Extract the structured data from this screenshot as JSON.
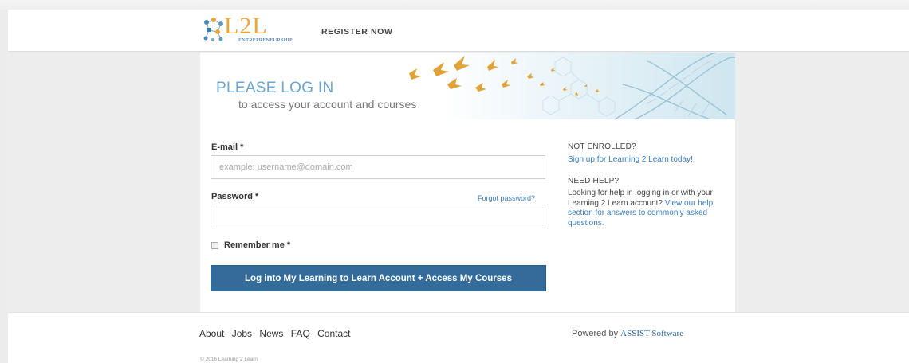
{
  "header": {
    "logo": {
      "main_text": "L2L",
      "sub_text": "ENTREPRENEURSHIP"
    },
    "register_label": "REGISTER NOW"
  },
  "banner": {
    "title": "PLEASE LOG IN",
    "subtitle": "to access your account and courses"
  },
  "form": {
    "email_label": "E-mail *",
    "email_placeholder": "example: username@domain.com",
    "email_value": "",
    "password_label": "Password *",
    "password_value": "",
    "forgot_label": "Forgot password?",
    "remember_label": "Remember me *",
    "remember_checked": false,
    "submit_label": "Log into My Learning to Learn Account  +  Access My Courses"
  },
  "sidebar": {
    "not_enrolled_heading": "NOT ENROLLED?",
    "signup_link": "Sign up for Learning 2 Learn today!",
    "need_help_heading": "NEED HELP?",
    "help_text": "Looking for help in logging in or with your Learning 2 Learn account?",
    "help_link": "View our help section for answers to commonly asked questions."
  },
  "footer": {
    "links": [
      "About",
      "Jobs",
      "News",
      "FAQ",
      "Contact"
    ],
    "powered_by": "Powered by",
    "powered_link": "ASSIST Software",
    "copyright": "© 2016 Learning 2 Learn"
  },
  "colors": {
    "primary_button": "#336c9a",
    "link": "#3b7dbb",
    "title_blue": "#6aa6cf",
    "logo_orange": "#e8a637",
    "page_bg": "#ececec"
  }
}
